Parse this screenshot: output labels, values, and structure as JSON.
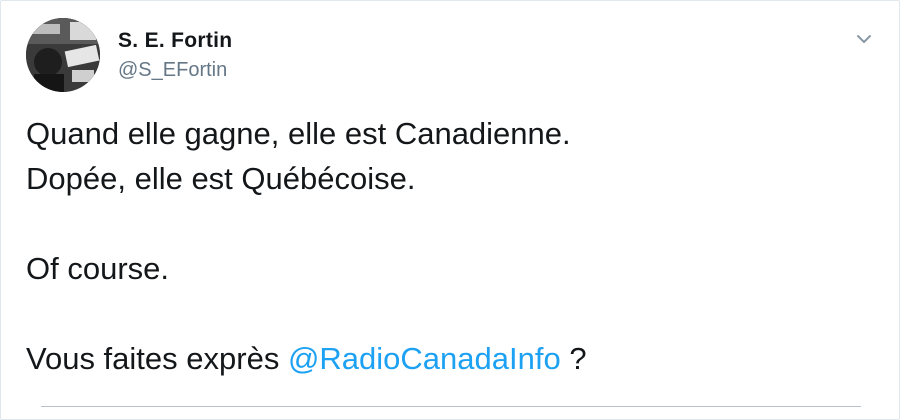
{
  "author": {
    "display_name": "S. E. Fortin",
    "handle": "@S_EFortin",
    "avatar_icon": "avatar-photo"
  },
  "menu": {
    "icon": "chevron-down-icon"
  },
  "tweet": {
    "line1": "Quand elle gagne, elle est Canadienne.",
    "line2": "Dopée, elle est Québécoise.",
    "line3": "Of course.",
    "line4_prefix": "Vous faites exprès ",
    "line4_mention": "@RadioCanadaInfo",
    "line4_suffix": " ?"
  },
  "colors": {
    "text": "#14171a",
    "secondary": "#657786",
    "link": "#1da1f2",
    "border": "#e1e8ed"
  }
}
